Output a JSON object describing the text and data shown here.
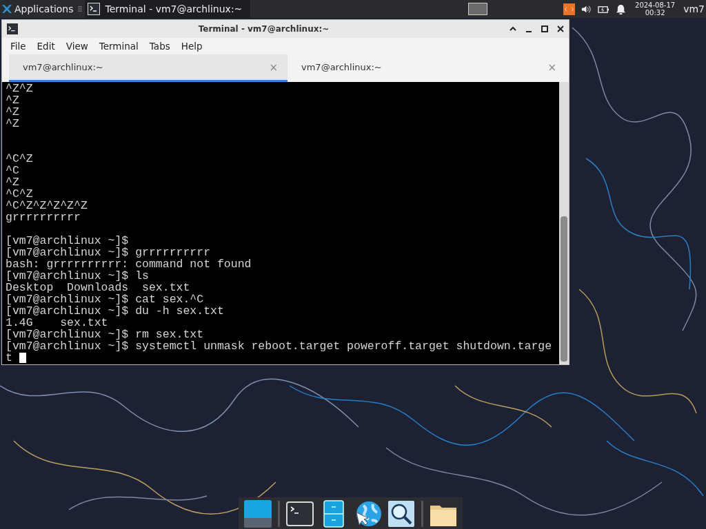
{
  "top_panel": {
    "applications_label": "Applications",
    "task": {
      "title": "Terminal - vm7@archlinux:~",
      "selected": true
    },
    "clock": {
      "date": "2024-08-17",
      "time": "00:32"
    },
    "user": "vm7"
  },
  "window": {
    "title": "Terminal - vm7@archlinux:~",
    "menu": [
      "File",
      "Edit",
      "View",
      "Terminal",
      "Tabs",
      "Help"
    ],
    "tabs": [
      {
        "label": "vm7@archlinux:~",
        "close": "×",
        "selected": true
      },
      {
        "label": "vm7@archlinux:~",
        "close": "×",
        "selected": false
      }
    ]
  },
  "terminal": {
    "lines": [
      {
        "kind": "text",
        "text": "^Z^Z"
      },
      {
        "kind": "text",
        "text": "^Z"
      },
      {
        "kind": "text",
        "text": "^Z"
      },
      {
        "kind": "text",
        "text": "^Z"
      },
      {
        "kind": "blank"
      },
      {
        "kind": "blank"
      },
      {
        "kind": "text",
        "text": "^C^Z"
      },
      {
        "kind": "text",
        "text": "^C"
      },
      {
        "kind": "text",
        "text": "^Z"
      },
      {
        "kind": "text",
        "text": "^C^Z"
      },
      {
        "kind": "text",
        "text": "^C^Z^Z^Z^Z^Z"
      },
      {
        "kind": "text",
        "text": "grrrrrrrrrr"
      },
      {
        "kind": "blank"
      },
      {
        "kind": "text",
        "text": "[vm7@archlinux ~]$"
      },
      {
        "kind": "text",
        "text": "[vm7@archlinux ~]$ grrrrrrrrrr"
      },
      {
        "kind": "text",
        "text": "bash: grrrrrrrrrr: command not found"
      },
      {
        "kind": "text",
        "text": "[vm7@archlinux ~]$ ls"
      },
      {
        "kind": "text",
        "text": "Desktop  Downloads  sex.txt"
      },
      {
        "kind": "text",
        "text": "[vm7@archlinux ~]$ cat sex.^C"
      },
      {
        "kind": "text",
        "text": "[vm7@archlinux ~]$ du -h sex.txt"
      },
      {
        "kind": "text",
        "text": "1.4G    sex.txt"
      },
      {
        "kind": "text",
        "text": "[vm7@archlinux ~]$ rm sex.txt"
      },
      {
        "kind": "text",
        "text": "[vm7@archlinux ~]$ systemctl unmask reboot.target poweroff.target shutdown.targe"
      },
      {
        "kind": "text",
        "text": "t",
        "cursor": true
      }
    ]
  },
  "dock": {
    "items": [
      {
        "kind": "desktop"
      },
      {
        "kind": "separator"
      },
      {
        "kind": "terminal"
      },
      {
        "kind": "cabinet"
      },
      {
        "kind": "globe"
      },
      {
        "kind": "search"
      },
      {
        "kind": "separator"
      },
      {
        "kind": "folder"
      }
    ]
  }
}
